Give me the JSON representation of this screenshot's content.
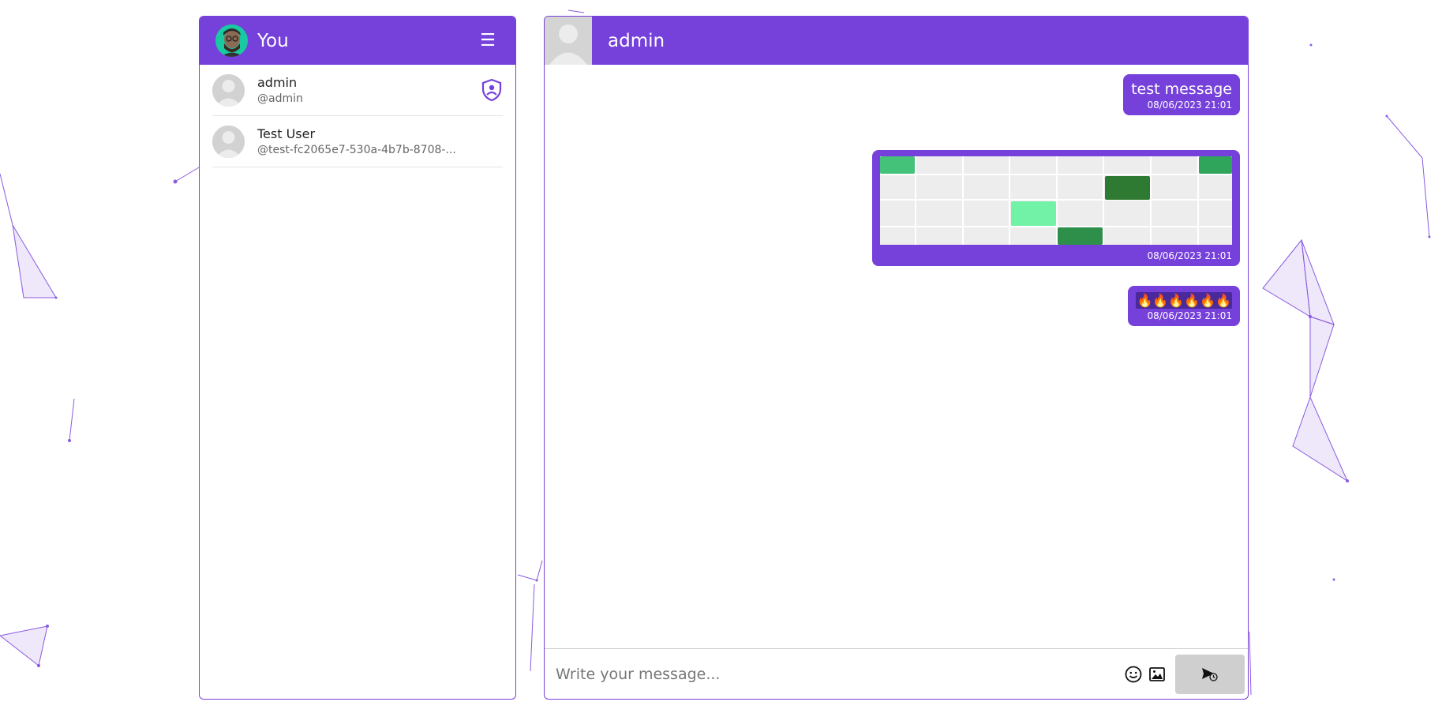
{
  "colors": {
    "accent": "#7640da",
    "bg_shapes": "#7a3fd8",
    "avatar_bg": "#19c9a2"
  },
  "sidebar": {
    "title": "You",
    "menu_icon": "hamburger-icon",
    "contacts": [
      {
        "name": "admin",
        "handle": "@admin",
        "badge_icon": "admin-shield-icon"
      },
      {
        "name": "Test User",
        "handle": "@test-fc2065e7-530a-4b7b-8708-..."
      }
    ]
  },
  "chat": {
    "title": "admin",
    "messages": [
      {
        "type": "text",
        "text": "test message",
        "time": "08/06/2023 21:01"
      },
      {
        "type": "image",
        "time": "08/06/2023 21:01"
      },
      {
        "type": "emoji",
        "text": "🔥🔥🔥🔥🔥🔥",
        "time": "08/06/2023 21:01"
      }
    ],
    "composer": {
      "placeholder": "Write your message...",
      "emoji_icon": "smiley-icon",
      "image_icon": "image-icon",
      "send_icon": "send-icon"
    }
  }
}
